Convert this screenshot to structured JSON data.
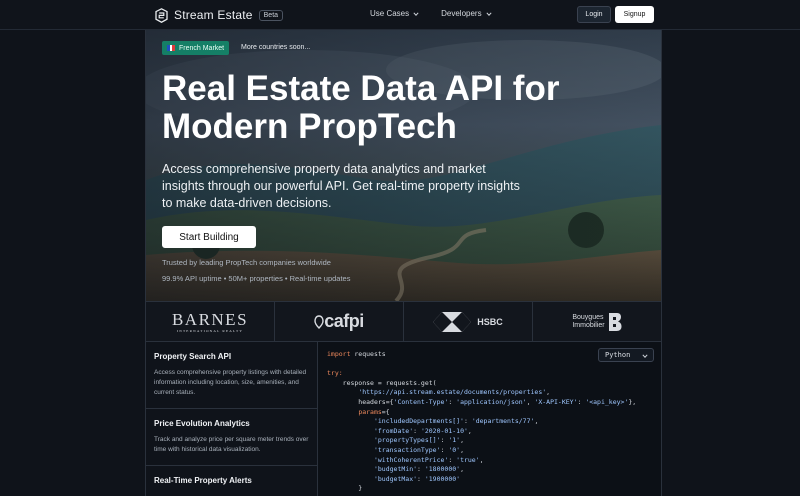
{
  "brand": {
    "name": "Stream Estate",
    "badge": "Beta"
  },
  "nav": {
    "links": [
      {
        "label": "Use Cases"
      },
      {
        "label": "Developers"
      }
    ],
    "login": "Login",
    "signup": "Signup"
  },
  "hero": {
    "market_pill": "French Market",
    "more_countries": "More countries soon...",
    "title": "Real Estate Data API for Modern PropTech",
    "lead": "Access comprehensive property data analytics and market insights through our powerful API. Get real-time property insights to make data-driven decisions.",
    "cta": "Start Building",
    "trusted": "Trusted by leading PropTech companies worldwide",
    "stats": "99.9% API uptime • 50M+ properties • Real-time updates"
  },
  "logos": [
    {
      "name": "BARNES",
      "sub": "INTERNATIONAL REALTY"
    },
    {
      "name": "cafpi"
    },
    {
      "name": "HSBC"
    },
    {
      "name_line1": "Bouygues",
      "name_line2": "Immobilier"
    }
  ],
  "features": [
    {
      "title": "Property Search API",
      "desc": "Access comprehensive property listings with detailed information including location, size, amenities, and current status."
    },
    {
      "title": "Price Evolution Analytics",
      "desc": "Track and analyze price per square meter trends over time with historical data visualization."
    },
    {
      "title": "Real-Time Property Alerts",
      "desc": ""
    }
  ],
  "code": {
    "language": "Python",
    "lines": [
      "import requests",
      "",
      "try:",
      "    response = requests.get(",
      "        'https://api.stream.estate/documents/properties',",
      "        headers={'Content-Type': 'application/json', 'X-API-KEY': '<api_key>'},",
      "        params={",
      "            'includedDepartments[]': 'departments/77',",
      "            'fromDate': '2020-01-10',",
      "            'propertyTypes[]': '1',",
      "            'transactionType': '0',",
      "            'withCoherentPrice': 'true',",
      "            'budgetMin': '1800000',",
      "            'budgetMax': '1900000'",
      "        }"
    ]
  },
  "colors": {
    "accent_green": "#157f66",
    "code_keyword": "#f08a5d",
    "code_string": "#9fc7ff"
  }
}
